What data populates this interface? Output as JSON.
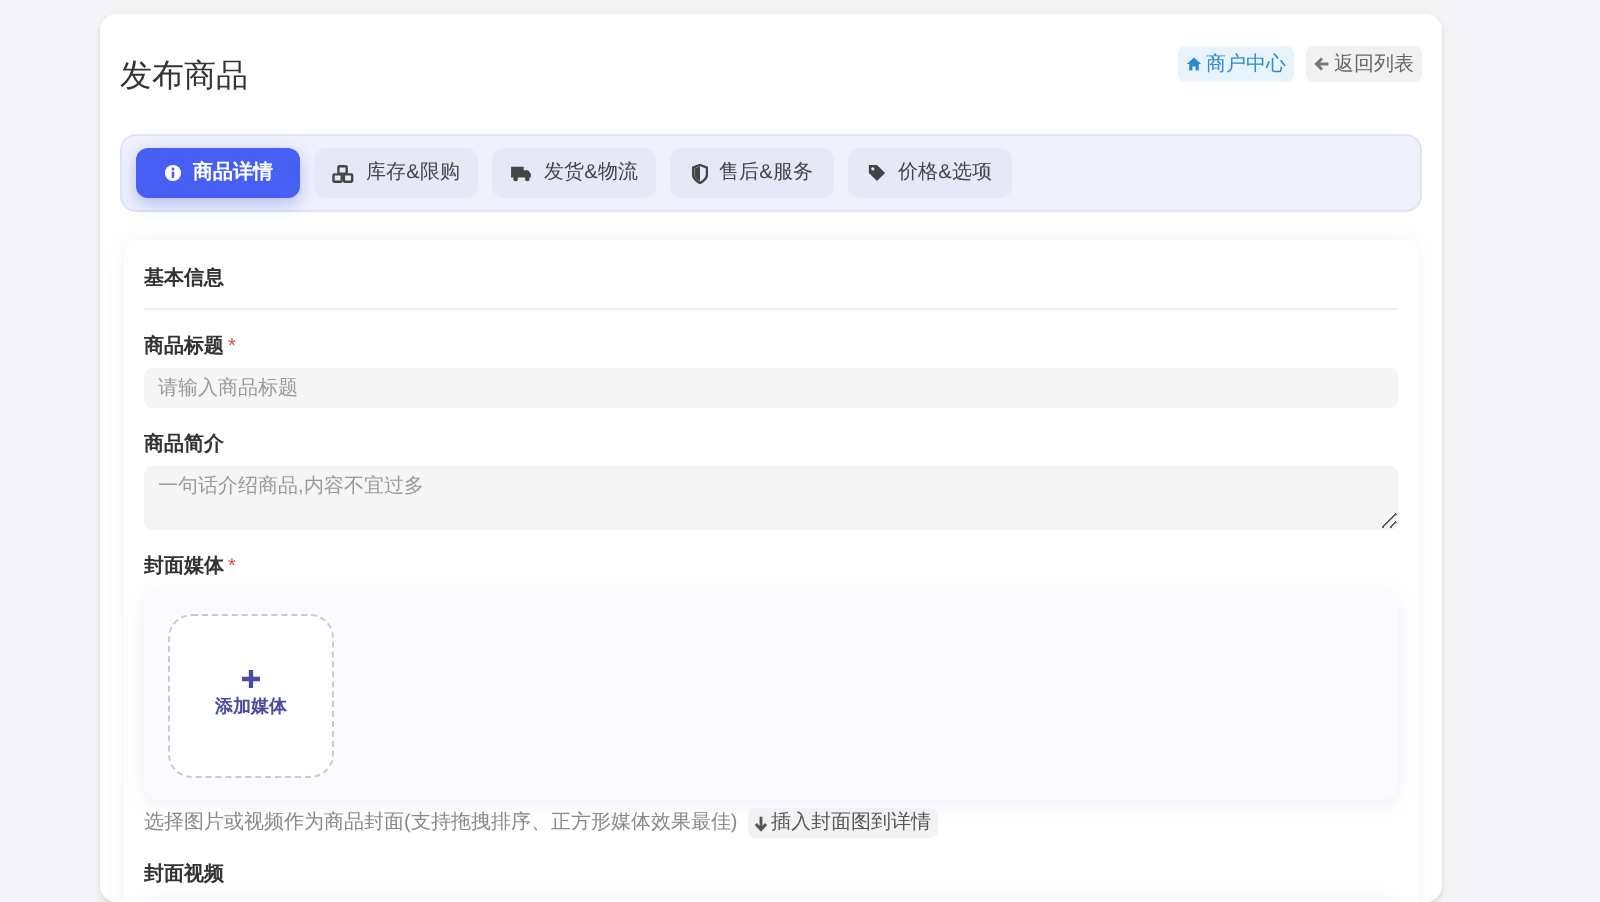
{
  "page": {
    "title": "发布商品"
  },
  "header_buttons": [
    {
      "kind": "merchant",
      "label": "商户中心"
    },
    {
      "kind": "back",
      "label": "返回列表"
    }
  ],
  "tabs": [
    {
      "label": "商品详情",
      "selected": true
    },
    {
      "label": "库存&限购",
      "selected": false
    },
    {
      "label": "发货&物流",
      "selected": false
    },
    {
      "label": "售后&服务",
      "selected": false
    },
    {
      "label": "价格&选项",
      "selected": false
    }
  ],
  "section": {
    "title": "基本信息",
    "fields": [
      {
        "kind": "input",
        "label": "商品标题",
        "required_mark": "*",
        "placeholder": "请输入商品标题"
      },
      {
        "kind": "textarea",
        "label": "商品简介",
        "placeholder": "一句话介绍商品,内容不宜过多"
      },
      {
        "kind": "media",
        "label": "封面媒体",
        "required_mark": "*",
        "add_label": "添加媒体",
        "hint": "选择图片或视频作为商品封面(支持拖拽排序、正方形媒体效果最佳)",
        "action": "插入封面图到详情"
      },
      {
        "kind": "video",
        "label": "封面视频"
      }
    ]
  }
}
